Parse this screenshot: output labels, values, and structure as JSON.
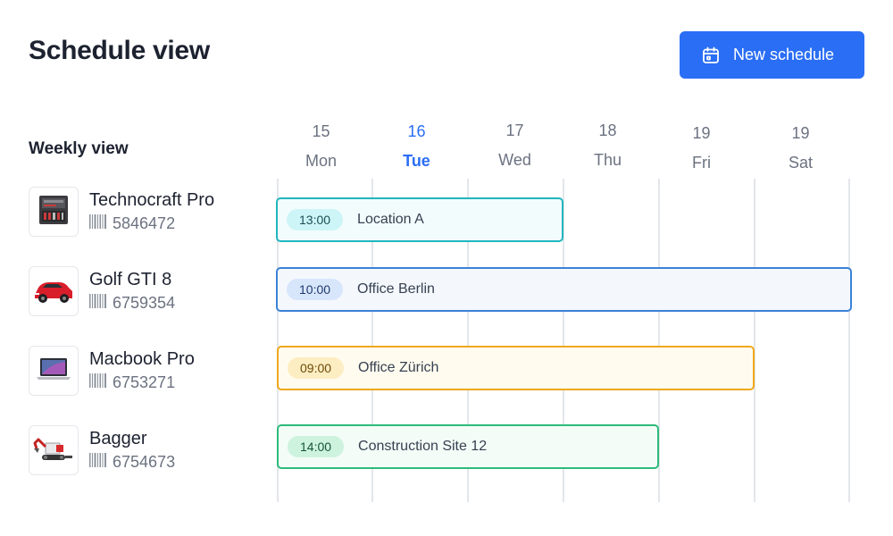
{
  "header": {
    "title": "Schedule view",
    "new_button_label": "New schedule"
  },
  "weekly_label": "Weekly view",
  "days": [
    {
      "num": "15",
      "name": "Mon"
    },
    {
      "num": "16",
      "name": "Tue"
    },
    {
      "num": "17",
      "name": "Wed"
    },
    {
      "num": "18",
      "name": "Thu"
    },
    {
      "num": "19",
      "name": "Fri"
    },
    {
      "num": "19",
      "name": "Sat"
    }
  ],
  "assets": [
    {
      "name": "Technocraft Pro",
      "id": "5846472",
      "icon": "toolbox-icon"
    },
    {
      "name": "Golf GTI 8",
      "id": "6759354",
      "icon": "car-icon"
    },
    {
      "name": "Macbook Pro",
      "id": "6753271",
      "icon": "laptop-icon"
    },
    {
      "name": "Bagger",
      "id": "6754673",
      "icon": "excavator-icon"
    }
  ],
  "events": [
    {
      "time": "13:00",
      "location": "Location A",
      "border": "#20b6bd",
      "bg": "#f2fcfd",
      "badge_bg": "#cdf5f7",
      "badge_text": "#1b4e55"
    },
    {
      "time": "10:00",
      "location": "Office Berlin",
      "border": "#3b82d6",
      "bg": "#f4f8fd",
      "badge_bg": "#d8e6fb",
      "badge_text": "#1e3a6e"
    },
    {
      "time": "09:00",
      "location": "Office Zürich",
      "border": "#f0a81c",
      "bg": "#fffcef",
      "badge_bg": "#fdedc2",
      "badge_text": "#6b4a06"
    },
    {
      "time": "14:00",
      "location": "Construction Site 12",
      "border": "#2dbb7a",
      "bg": "#f3fcf7",
      "badge_bg": "#cdf3df",
      "badge_text": "#175537"
    }
  ]
}
